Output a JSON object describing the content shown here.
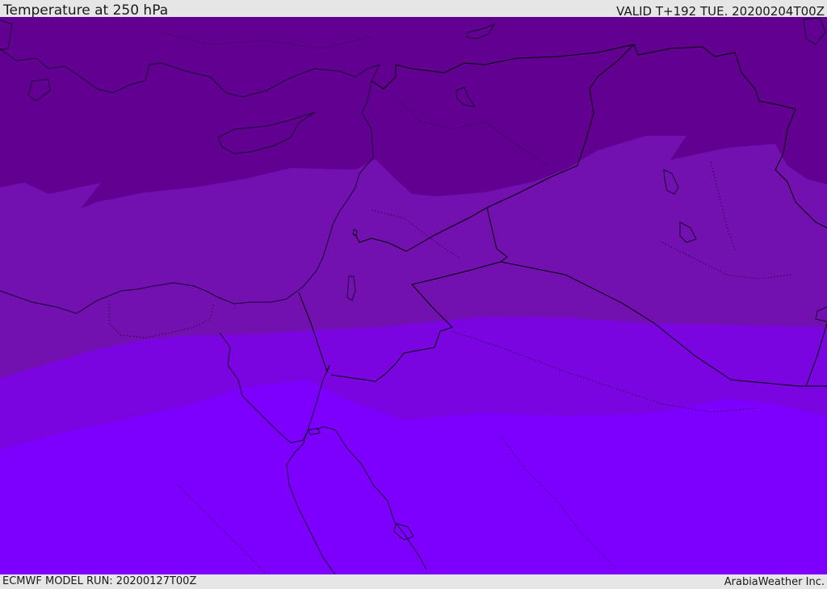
{
  "header": {
    "title": "Temperature at 250 hPa",
    "valid": "VALID T+192 TUE. 20200204T00Z"
  },
  "footer": {
    "model_run": "ECMWF MODEL RUN: 20200127T00Z",
    "credit": "ArabiaWeather Inc."
  },
  "colors": {
    "band_darkest": "#620092",
    "band_dark": "#7210b0",
    "band_mid": "#7a05e0",
    "band_light": "#7d00ff",
    "coastline": "#1a0033",
    "border": "#000000"
  }
}
